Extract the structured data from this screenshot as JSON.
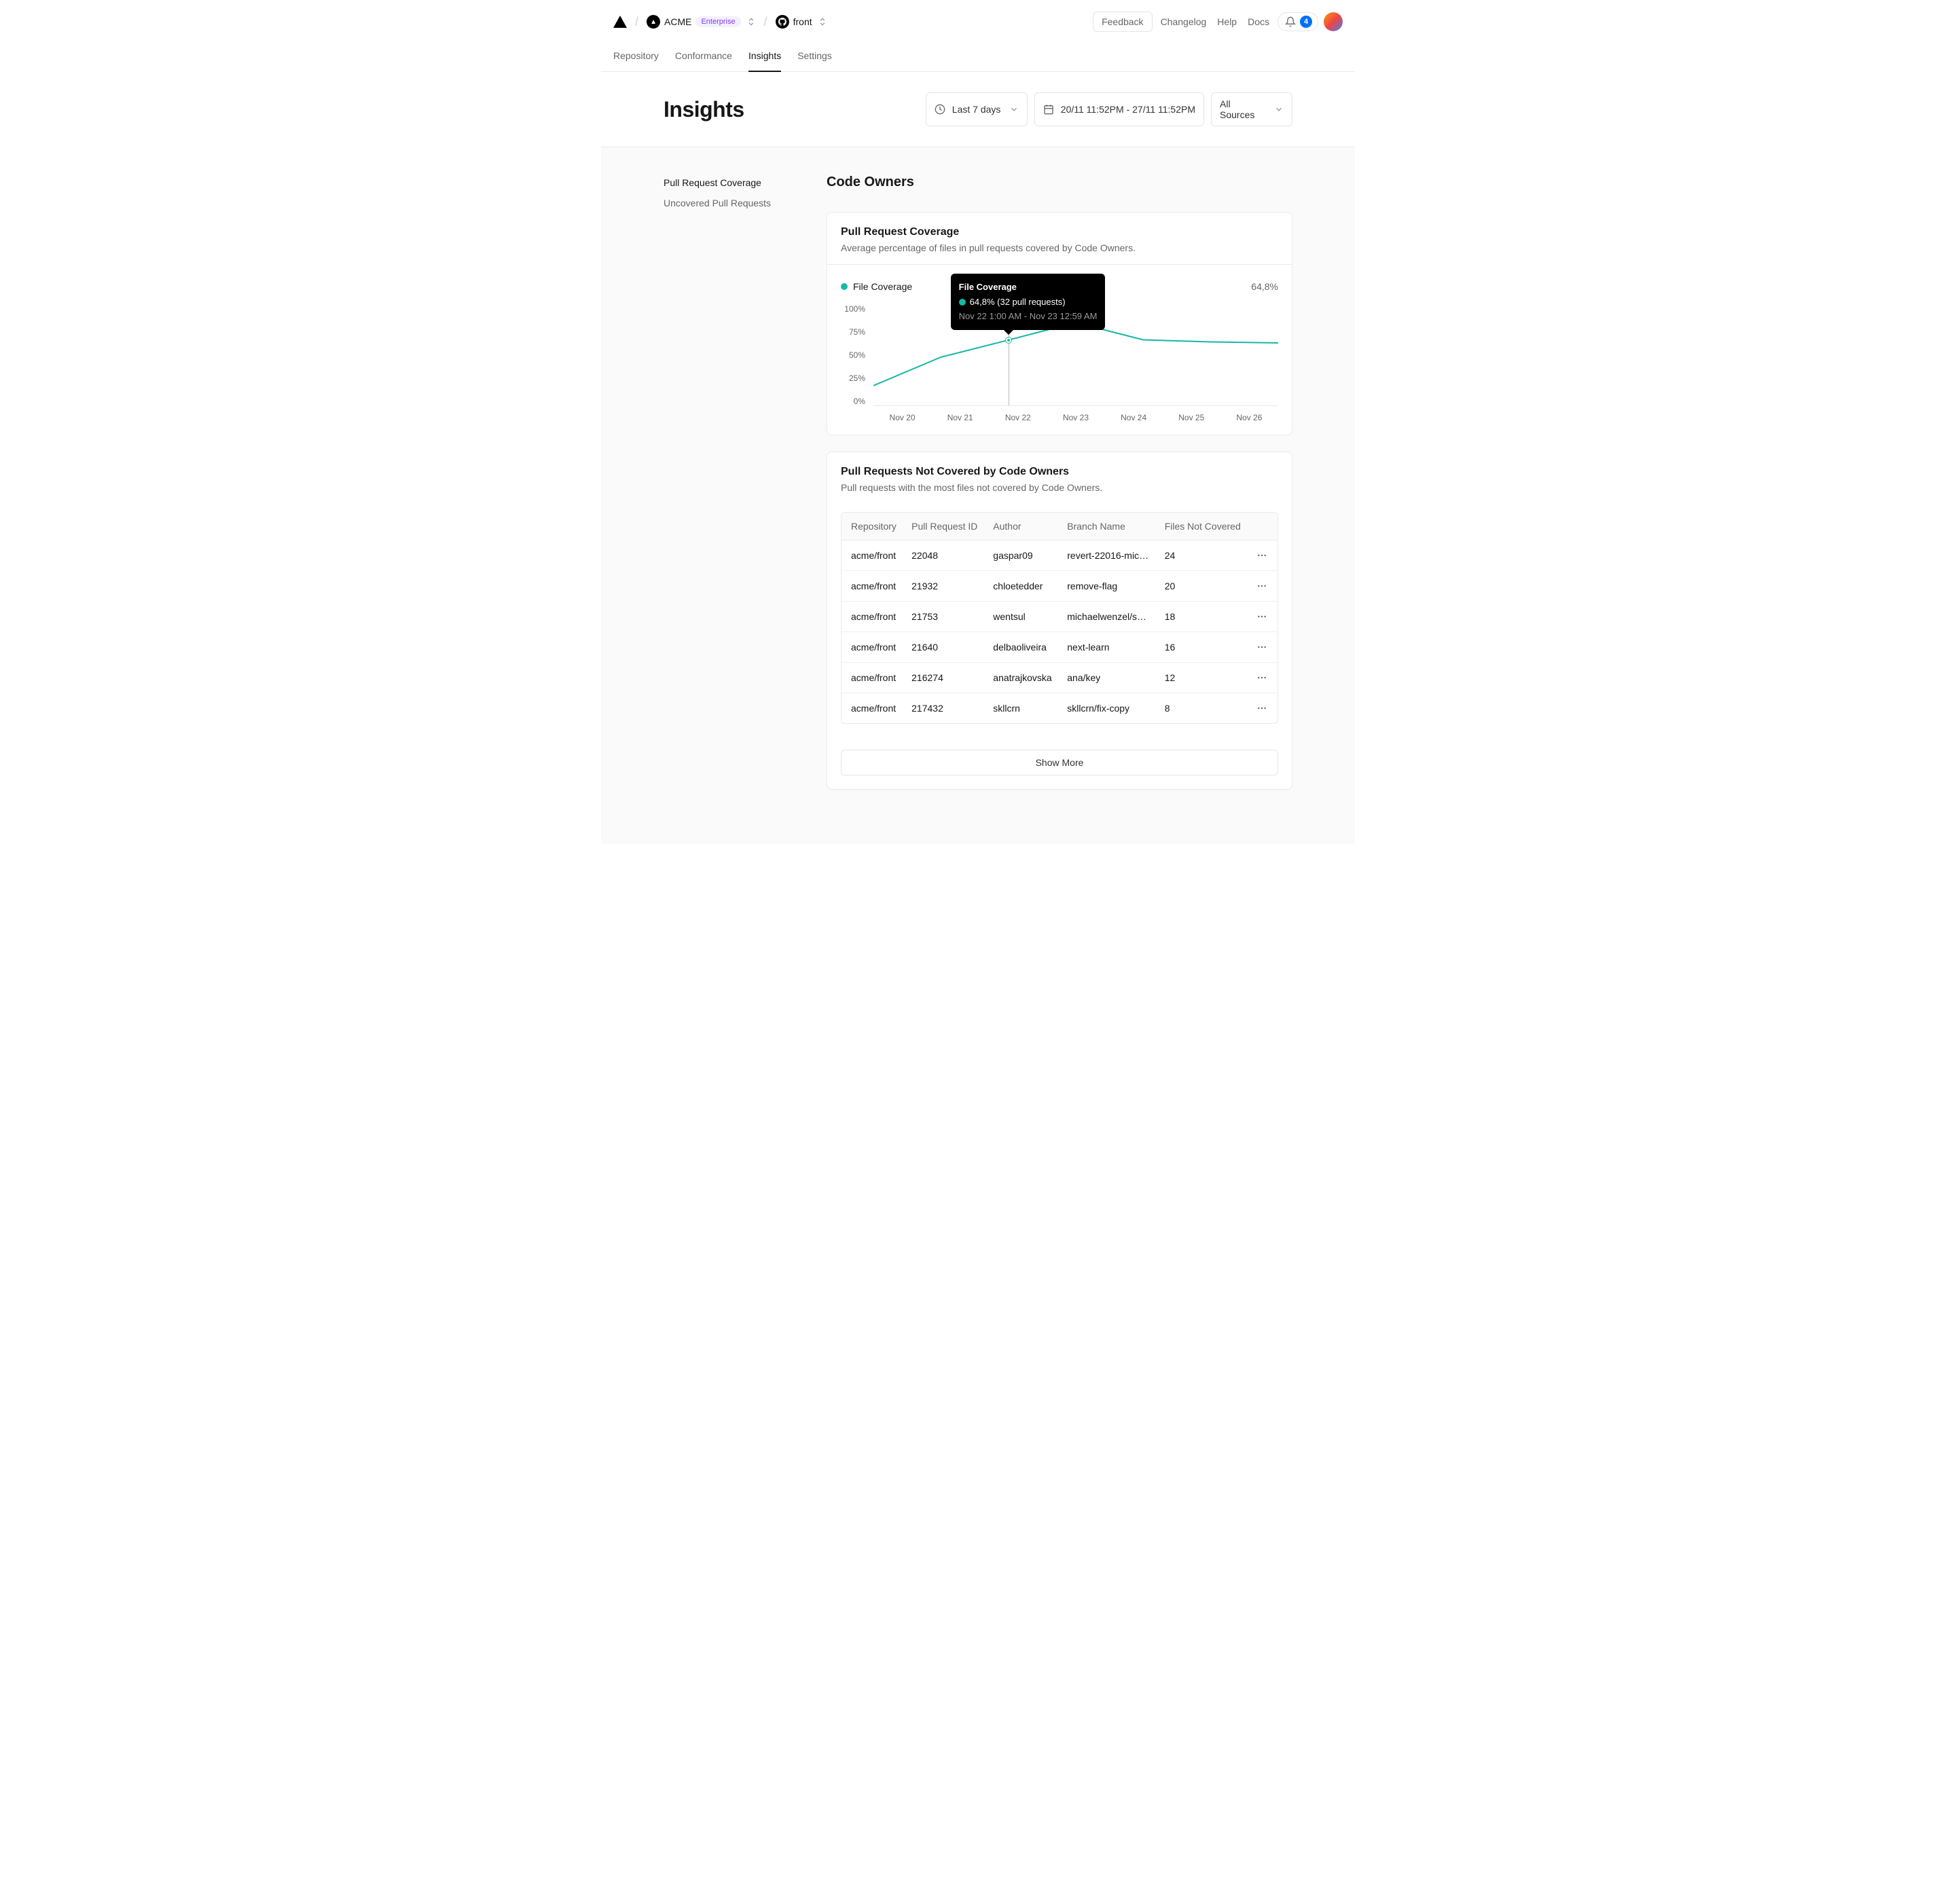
{
  "topbar": {
    "org": "ACME",
    "org_badge": "Enterprise",
    "repo": "front",
    "feedback": "Feedback",
    "changelog": "Changelog",
    "help": "Help",
    "docs": "Docs",
    "notification_count": "4"
  },
  "tabs": [
    "Repository",
    "Conformance",
    "Insights",
    "Settings"
  ],
  "active_tab": "Insights",
  "page": {
    "title": "Insights",
    "range_label": "Last 7 days",
    "date_range": "20/11 11:52PM - 27/11 11:52PM",
    "sources": "All Sources"
  },
  "sidebar": {
    "items": [
      "Pull Request Coverage",
      "Uncovered Pull Requests"
    ],
    "active": "Pull Request Coverage"
  },
  "section_title": "Code Owners",
  "coverage_card": {
    "title": "Pull Request Coverage",
    "subtitle": "Average percentage of files in pull requests covered by Code Owners.",
    "legend": "File Coverage",
    "current_value": "64,8%"
  },
  "chart_data": {
    "type": "line",
    "title": "Pull Request Coverage",
    "xlabel": "",
    "ylabel": "",
    "ylim": [
      0,
      100
    ],
    "y_ticks": [
      "100%",
      "75%",
      "50%",
      "25%",
      "0%"
    ],
    "categories": [
      "Nov 20",
      "Nov 21",
      "Nov 22",
      "Nov 23",
      "Nov 24",
      "Nov 25",
      "Nov 26"
    ],
    "series": [
      {
        "name": "File Coverage",
        "color": "#14b8a6",
        "values": [
          20,
          48,
          64.8,
          82,
          65,
          63,
          62
        ]
      }
    ],
    "tooltip": {
      "title": "File Coverage",
      "value": "64,8% (32 pull requests)",
      "sub": "Nov 22 1:00 AM - Nov 23 12:59 AM",
      "at_index": 2
    }
  },
  "uncovered_card": {
    "title": "Pull Requests Not Covered by Code Owners",
    "subtitle": "Pull requests with the most files not covered by Code Owners.",
    "columns": [
      "Repository",
      "Pull Request ID",
      "Author",
      "Branch Name",
      "Files Not Covered"
    ],
    "rows": [
      {
        "repo": "acme/front",
        "pr": "22048",
        "author": "gaspar09",
        "branch": "revert-22016-michae...",
        "files": "24"
      },
      {
        "repo": "acme/front",
        "pr": "21932",
        "author": "chloetedder",
        "branch": "remove-flag",
        "files": "20"
      },
      {
        "repo": "acme/front",
        "pr": "21753",
        "author": "wentsul",
        "branch": "michaelwenzel/surf...",
        "files": "18"
      },
      {
        "repo": "acme/front",
        "pr": "21640",
        "author": "delbaoliveira",
        "branch": "next-learn",
        "files": "16"
      },
      {
        "repo": "acme/front",
        "pr": "216274",
        "author": "anatrajkovska",
        "branch": "ana/key",
        "files": "12"
      },
      {
        "repo": "acme/front",
        "pr": "217432",
        "author": "skllcrn",
        "branch": "skllcrn/fix-copy",
        "files": "8"
      }
    ],
    "show_more": "Show More"
  }
}
